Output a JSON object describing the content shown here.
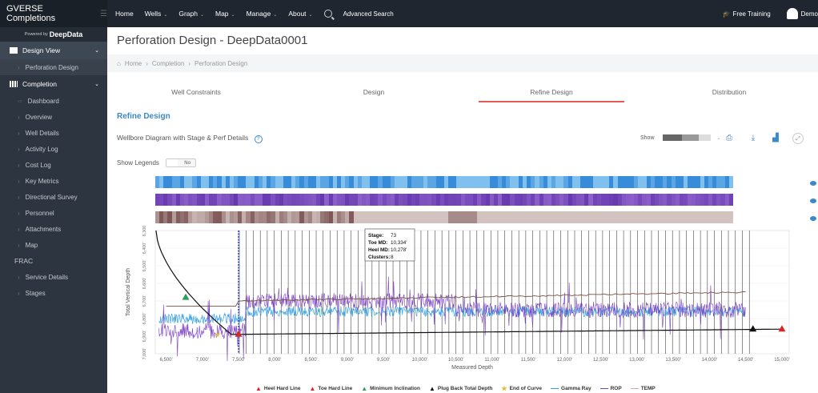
{
  "topbar": {
    "brand": "GVERSE Completions",
    "nav": [
      {
        "label": "Home",
        "has_menu": false
      },
      {
        "label": "Wells",
        "has_menu": true
      },
      {
        "label": "Graph",
        "has_menu": true
      },
      {
        "label": "Map",
        "has_menu": true
      },
      {
        "label": "Manage",
        "has_menu": true
      },
      {
        "label": "About",
        "has_menu": true
      }
    ],
    "advanced_search": "Advanced Search",
    "free_training": "Free Training",
    "user": "Demo"
  },
  "sidebar": {
    "powered_by": "Powered by",
    "powered_brand": "DeepData",
    "design_view": "Design View",
    "design_items": [
      "Perforation Design"
    ],
    "completion": "Completion",
    "completion_items": [
      "Dashboard",
      "Overview",
      "Well Details",
      "Activity Log",
      "Cost Log",
      "Key Metrics",
      "Directional Survey",
      "Personnel",
      "Attachments",
      "Map"
    ],
    "frac": "FRAC",
    "frac_items": [
      "Service Details",
      "Stages"
    ]
  },
  "main": {
    "title": "Perforation Design - DeepData0001",
    "breadcrumb": [
      "Home",
      "Completion",
      "Perforation Design"
    ],
    "tabs": [
      "Well Constraints",
      "Design",
      "Refine Design",
      "Distribution"
    ],
    "active_tab": 2,
    "section_title": "Refine Design",
    "sub_head": "Wellbore Diagram with Stage & Perf Details",
    "show_label": "Show",
    "show_legends_label": "Show Legends",
    "toggle_value": "No"
  },
  "tooltip": {
    "stage_label": "Stage:",
    "stage": "73",
    "toe_label": "Toe MD:",
    "toe": "10,334'",
    "heel_label": "Heel MD:",
    "heel": "10,278'",
    "clusters_label": "Clusters:",
    "clusters": "8"
  },
  "colors": {
    "strip1": "#7fc0ee",
    "strip1_dark": "#2f86d6",
    "strip2": "#9d72d6",
    "strip2_dark": "#5c2ea8",
    "strip3": "#d9cbc8",
    "strip3_dark": "#6b3f3f",
    "gamma": "#3aa3e3",
    "rop": "#7b3fc4",
    "temp": "#7a5040",
    "tvd": "#111111"
  },
  "chart_data": {
    "type": "line",
    "xlabel": "Measured Depth",
    "ylabel": "Total Vertical Depth",
    "x_ticks": [
      "6,500'",
      "7,000'",
      "7,500'",
      "8,000'",
      "8,500'",
      "9,000'",
      "9,500'",
      "10,000'",
      "10,500'",
      "11,000'",
      "11,500'",
      "12,000'",
      "12,500'",
      "13,000'",
      "13,500'",
      "14,000'",
      "14,500'",
      "15,000'"
    ],
    "y_ticks": [
      "6,300'",
      "6,400'",
      "6,500'",
      "6,600'",
      "6,700'",
      "6,800'",
      "6,900'",
      "7,000'"
    ],
    "xlim": [
      6350,
      15100
    ],
    "ylim": [
      6300,
      7000
    ],
    "legend": [
      {
        "name": "Heel Hard Line",
        "symbol": "triangle",
        "color": "#d62728"
      },
      {
        "name": "Toe Hard Line",
        "symbol": "triangle",
        "color": "#d62728"
      },
      {
        "name": "Minimum Inclination",
        "symbol": "triangle",
        "color": "#2ca05a"
      },
      {
        "name": "Plug Back Total Depth",
        "symbol": "triangle",
        "color": "#111111"
      },
      {
        "name": "End of Curve",
        "symbol": "star",
        "color": "#e8b830"
      },
      {
        "name": "Gamma Ray",
        "symbol": "line",
        "color": "#3aa3e3"
      },
      {
        "name": "ROP",
        "symbol": "line",
        "color": "#7b3fc4"
      },
      {
        "name": "TEMP",
        "symbol": "line",
        "color": "#d9a0b4"
      }
    ],
    "markers": {
      "minimum_inclination": {
        "x": 6770,
        "y": 6680
      },
      "end_of_curve": {
        "x": 7210,
        "y": 6890
      },
      "heel_hard_line": {
        "x": 7500,
        "y": 6890
      },
      "plug_back_total_depth": {
        "x": 14600,
        "y": 6860
      },
      "toe_hard_line": {
        "x": 15000,
        "y": 6860
      }
    },
    "stage_start_md": 7510,
    "stage_end_md": 14550,
    "stage_count": 73
  }
}
